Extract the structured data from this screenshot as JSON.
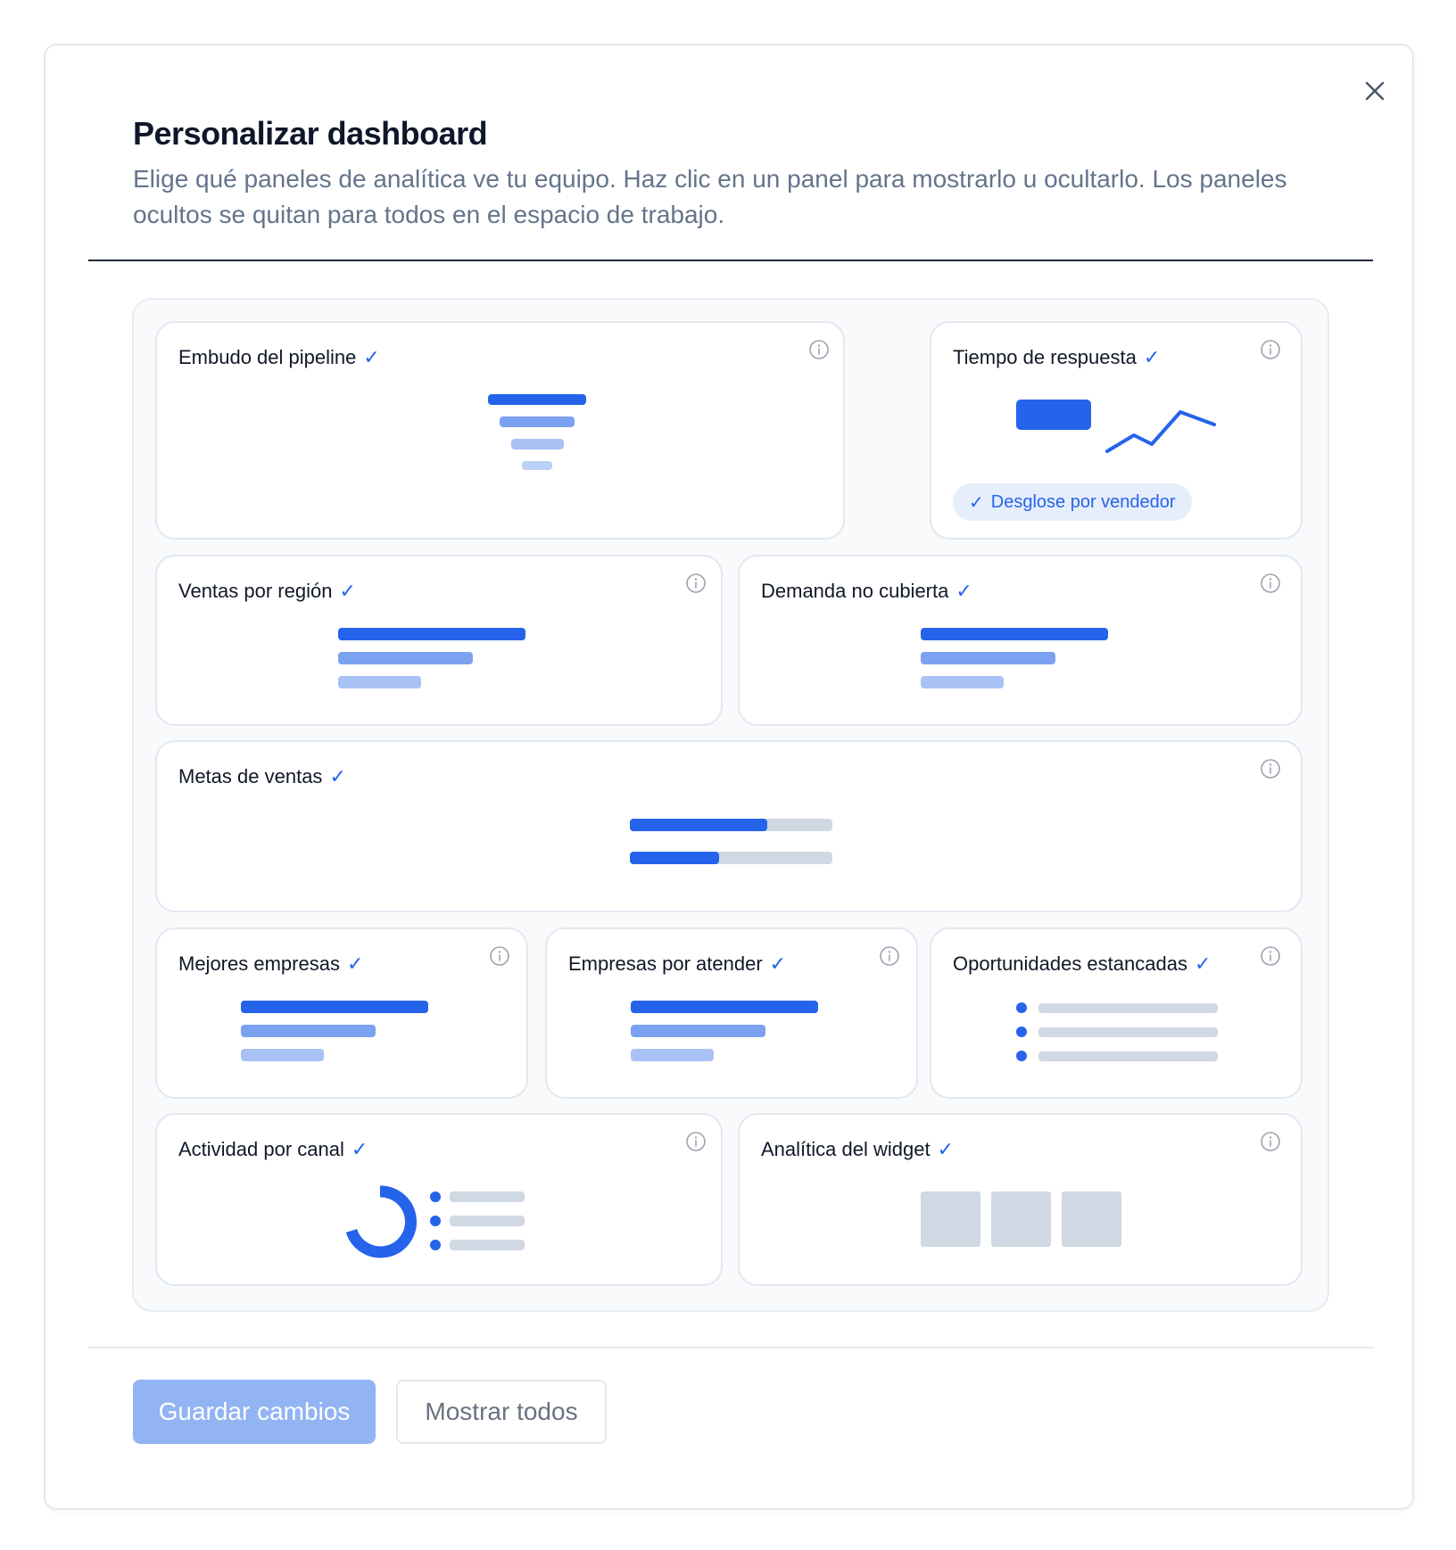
{
  "dialog": {
    "title": "Personalizar dashboard",
    "description": "Elige qué paneles de analítica ve tu equipo. Haz clic en un panel para mostrarlo u ocultarlo. Los paneles ocultos se quitan para todos en el espacio de trabajo.",
    "close_icon": "close-icon"
  },
  "colors": {
    "accent": "#2563eb",
    "primary_button_disabled": "#93b4f3",
    "placeholder_grey": "#cfd8e3"
  },
  "panels": [
    {
      "id": "pipeline-funnel",
      "title": "Embudo del pipeline",
      "selected": true,
      "icon": "info-icon"
    },
    {
      "id": "response-time",
      "title": "Tiempo de respuesta",
      "selected": true,
      "icon": "info-icon",
      "option": {
        "label": "Desglose por vendedor",
        "checked": true
      }
    },
    {
      "id": "sales-by-region",
      "title": "Ventas por región",
      "selected": true,
      "icon": "info-icon"
    },
    {
      "id": "unmet-demand",
      "title": "Demanda no cubierta",
      "selected": true,
      "icon": "info-icon"
    },
    {
      "id": "sales-goals",
      "title": "Metas de ventas",
      "selected": true,
      "icon": "info-icon",
      "progress": [
        0.68,
        0.44
      ]
    },
    {
      "id": "top-companies",
      "title": "Mejores empresas",
      "selected": true,
      "icon": "info-icon"
    },
    {
      "id": "companies-to-attend",
      "title": "Empresas por atender",
      "selected": true,
      "icon": "info-icon"
    },
    {
      "id": "stalled-opportunities",
      "title": "Oportunidades estancadas",
      "selected": true,
      "icon": "info-icon"
    },
    {
      "id": "activity-by-channel",
      "title": "Actividad por canal",
      "selected": true,
      "icon": "info-icon"
    },
    {
      "id": "widget-analytics",
      "title": "Analítica del widget",
      "selected": true,
      "icon": "info-icon"
    }
  ],
  "check_glyph": "✓",
  "footer": {
    "save_label": "Guardar cambios",
    "save_disabled": true,
    "show_all_label": "Mostrar todos"
  }
}
